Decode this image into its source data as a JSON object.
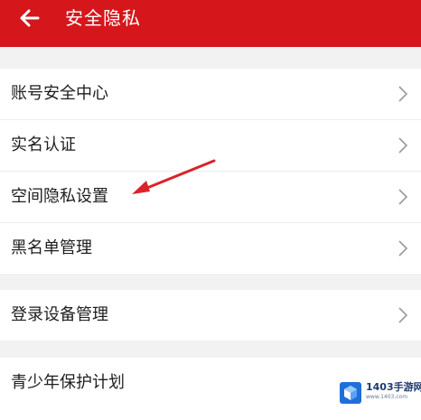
{
  "header": {
    "title": "安全隐私",
    "back_icon": "arrow-left-icon",
    "background_color": "#d5171c"
  },
  "groups": [
    {
      "items": [
        {
          "label": "账号安全中心",
          "icon": "chevron-right-icon"
        },
        {
          "label": "实名认证",
          "icon": "chevron-right-icon"
        },
        {
          "label": "空间隐私设置",
          "icon": "chevron-right-icon"
        },
        {
          "label": "黑名单管理",
          "icon": "chevron-right-icon"
        }
      ]
    },
    {
      "items": [
        {
          "label": "登录设备管理",
          "icon": "chevron-right-icon"
        }
      ]
    },
    {
      "items": [
        {
          "label": "青少年保护计划",
          "icon": "chevron-right-icon"
        }
      ]
    }
  ],
  "annotation": {
    "description_icon": "red-arrow-annotation-icon",
    "color": "#d9232a"
  },
  "watermark": {
    "text": "1403手游网",
    "subtext": "www.1403.com"
  }
}
